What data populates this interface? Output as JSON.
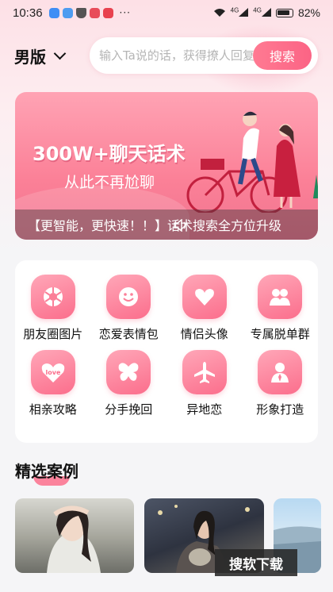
{
  "status": {
    "time": "10:36",
    "net1": "4G",
    "net2": "4G",
    "battery": "82%"
  },
  "header": {
    "gender": "男版",
    "search_placeholder": "输入Ta说的话，获得撩人回复",
    "search_button": "搜索"
  },
  "banner": {
    "title": "300W+聊天话术",
    "subtitle": "从此不再尬聊",
    "notice": "【更智能，更快速！！】话术搜索全方位升级"
  },
  "categories": [
    {
      "label": "朋友圈图片",
      "icon": "aperture-icon"
    },
    {
      "label": "恋爱表情包",
      "icon": "smiley-icon"
    },
    {
      "label": "情侣头像",
      "icon": "heart-icon"
    },
    {
      "label": "专属脱单群",
      "icon": "couple-icon"
    },
    {
      "label": "相亲攻略",
      "icon": "love-heart-icon"
    },
    {
      "label": "分手挽回",
      "icon": "butterfly-icon"
    },
    {
      "label": "异地恋",
      "icon": "airplane-icon"
    },
    {
      "label": "形象打造",
      "icon": "person-icon"
    }
  ],
  "featured": {
    "title": "精选案例"
  },
  "watermark": "搜软下载",
  "colors": {
    "accent": "#fb6e8c",
    "accent_light": "#ffa7b8",
    "background": "#f5f5f7"
  }
}
